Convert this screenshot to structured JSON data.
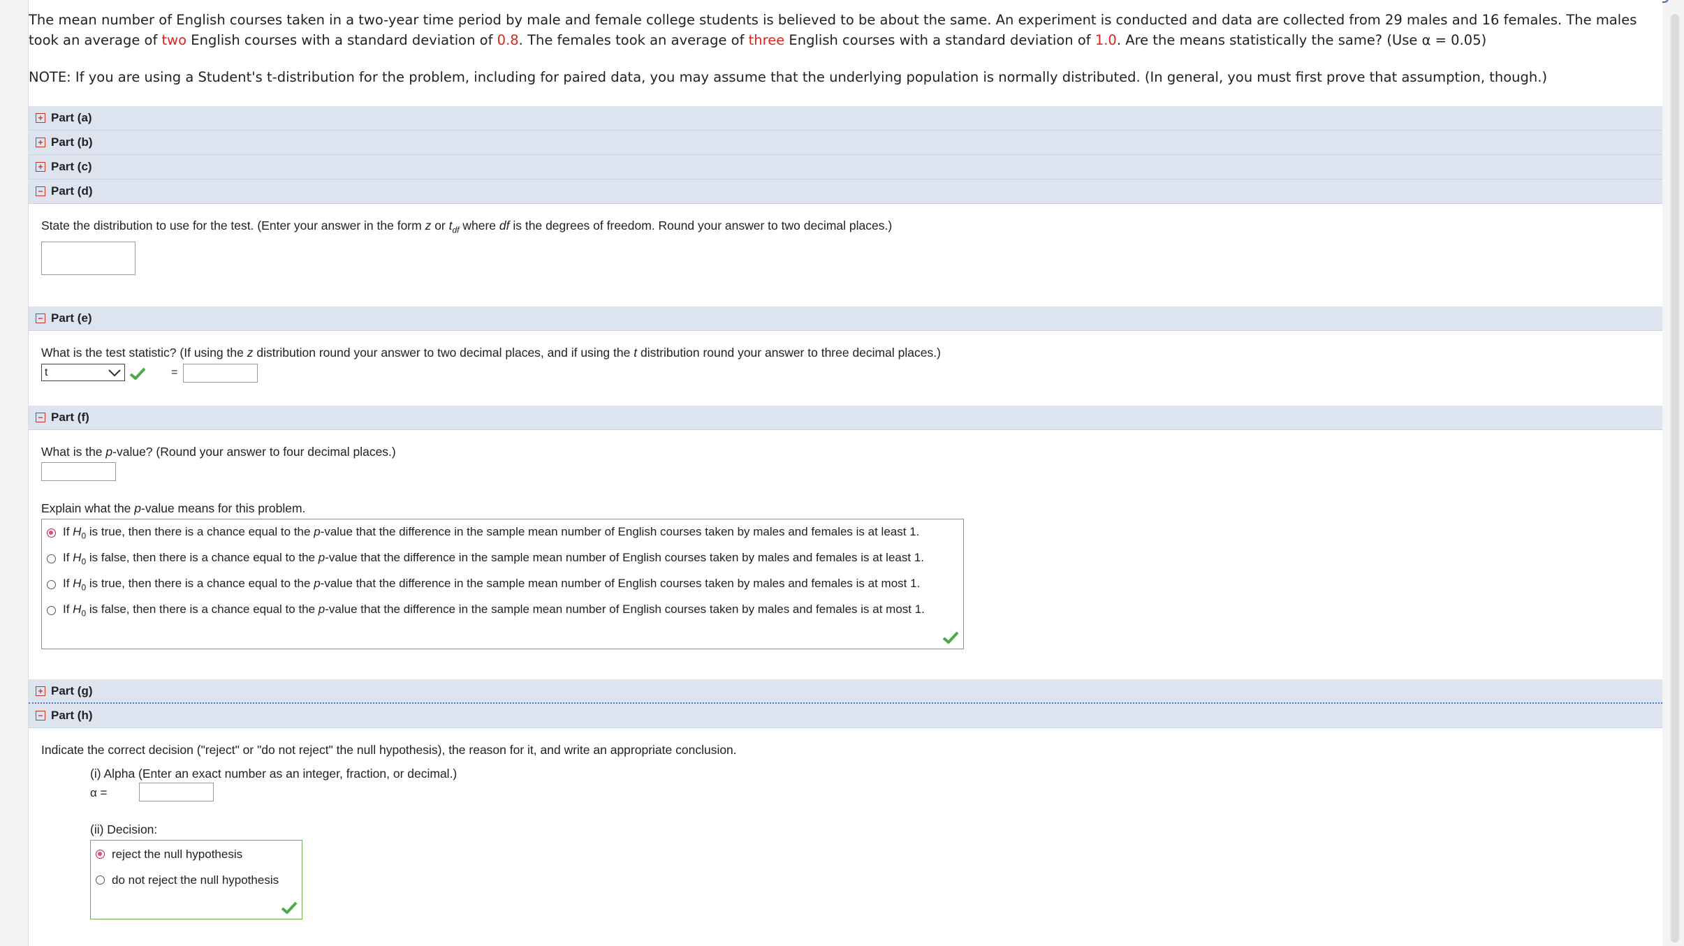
{
  "problem": {
    "text_1": "The mean number of English courses taken in a two-year time period by male and female college students is believed to be about the same. An experiment is conducted and data are collected from 29 males and 16 females. The males took an average of ",
    "males_avg": "two",
    "text_2": " English courses with a standard deviation of ",
    "males_sd": "0.8",
    "text_3": ". The females took an average of ",
    "females_avg": "three",
    "text_4": " English courses with a standard deviation of ",
    "females_sd": "1.0",
    "text_5": ". Are the means statistically the same? (Use α = 0.05)",
    "note": "NOTE: If you are using a Student's t-distribution for the problem, including for paired data, you may assume that the underlying population is normally distributed. (In general, you must first prove that assumption, though.)"
  },
  "parts": {
    "a": "Part (a)",
    "b": "Part (b)",
    "c": "Part (c)",
    "d": "Part (d)",
    "e": "Part (e)",
    "f": "Part (f)",
    "g": "Part (g)",
    "h": "Part (h)"
  },
  "part_d": {
    "q_1": "State the distribution to use for the test. (Enter your answer in the form ",
    "q_z": "z",
    "q_or": " or ",
    "q_t": "t",
    "q_df": "df",
    "q_2": " where ",
    "q_df2": "df",
    "q_3": " is the degrees of freedom. Round your answer to two decimal places.)",
    "answer": ""
  },
  "part_e": {
    "q_1": "What is the test statistic? (If using the ",
    "q_z": "z",
    "q_2": " distribution round your answer to two decimal places, and if using the ",
    "q_t": "t",
    "q_3": " distribution round your answer to three decimal places.)",
    "select_value": "t",
    "equals": "=",
    "answer": ""
  },
  "part_f": {
    "q_1": "What is the ",
    "q_p": "p",
    "q_2": "-value? (Round your answer to four decimal places.)",
    "answer": "",
    "explain_1": "Explain what the ",
    "explain_p": "p",
    "explain_2": "-value means for this problem.",
    "choices": [
      {
        "a": "If ",
        "h": "H",
        "s": "0",
        "b": " is true, then there is a chance equal to the ",
        "p": "p",
        "c": "-value that the difference in the sample mean number of English courses taken by males and females is at least 1."
      },
      {
        "a": "If ",
        "h": "H",
        "s": "0",
        "b": " is false, then there is a chance equal to the ",
        "p": "p",
        "c": "-value that the difference in the sample mean number of English courses taken by males and females is at least 1."
      },
      {
        "a": "If ",
        "h": "H",
        "s": "0",
        "b": " is true, then there is a chance equal to the ",
        "p": "p",
        "c": "-value that the difference in the sample mean number of English courses taken by males and females is at most 1."
      },
      {
        "a": "If ",
        "h": "H",
        "s": "0",
        "b": " is false, then there is a chance equal to the ",
        "p": "p",
        "c": "-value that the difference in the sample mean number of English courses taken by males and females is at most 1."
      }
    ]
  },
  "part_h": {
    "q": "Indicate the correct decision (\"reject\" or \"do not reject\" the null hypothesis), the reason for it, and write an appropriate conclusion.",
    "alpha_label": "(i) Alpha (Enter an exact number as an integer, fraction, or decimal.)",
    "alpha_eq": "α =",
    "alpha_answer": "",
    "decision_label": "(ii) Decision:",
    "decision_1": "reject the null hypothesis",
    "decision_2": "do not reject the null hypothesis"
  },
  "colors": {
    "header_bg": "#dde4ef",
    "highlight_red": "#d9261c",
    "correct_green": "#6eac57",
    "radio_selected": "#e04a8a"
  }
}
